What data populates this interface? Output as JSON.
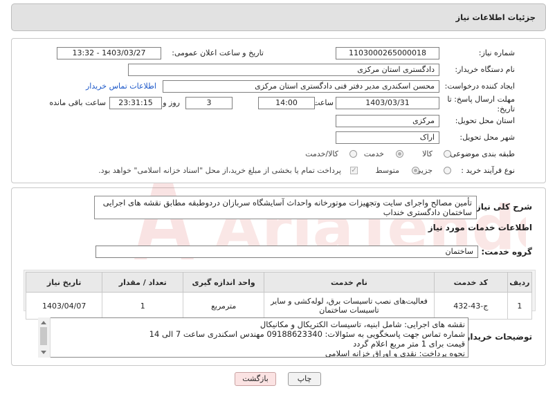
{
  "header": {
    "title": "جزئیات اطلاعات نیاز"
  },
  "form": {
    "need_number_label": "شماره نیاز:",
    "need_number": "1103000265000018",
    "announce_label": "تاریخ و ساعت اعلان عمومی:",
    "announce_value": "1403/03/27 - 13:32",
    "buyer_org_label": "نام دستگاه خریدار:",
    "buyer_org": "دادگستری استان مرکزی",
    "requester_label": "ایجاد کننده درخواست:",
    "requester": "محسن اسکندری مدیر دفتر فنی دادگستری استان مرکزی",
    "contact_link": "اطلاعات تماس خریدار",
    "deadline_label_1": "مهلت ارسال پاسخ: تا",
    "deadline_label_2": "تاریخ:",
    "deadline_date": "1403/03/31",
    "time_label": "ساعت",
    "deadline_time": "14:00",
    "days_value": "3",
    "days_label": "روز و",
    "remaining_time": "23:31:15",
    "remaining_label": "ساعت باقی مانده",
    "province_label": "استان محل تحویل:",
    "province": "مرکزی",
    "city_label": "شهر محل تحویل:",
    "city": "اراک",
    "category_label": "طبقه بندی موضوعی:",
    "category_options": [
      "کالا",
      "خدمت",
      "کالا/خدمت"
    ],
    "process_label": "نوع فرآیند خرید :",
    "process_options": [
      "جزیی",
      "متوسط"
    ],
    "payment_note": "پرداخت تمام یا بخشی از مبلغ خرید،از محل \"اسناد خزانه اسلامی\" خواهد بود."
  },
  "need": {
    "summary_label": "شرح کلی نیاز:",
    "summary": "تأمین مصالح واجرای سایت وتجهیزات موتورخانه واحداث آسایشگاه سربازان دردوطبقه مطابق نقشه های اجرایی ساختمان دادگستری خنداب",
    "services_title": "اطلاعات خدمات مورد نیاز",
    "service_group_label": "گروه خدمت:",
    "service_group": "ساختمان"
  },
  "table": {
    "headers": [
      "ردیف",
      "کد خدمت",
      "نام خدمت",
      "واحد اندازه گیری",
      "تعداد / مقدار",
      "تاریخ نیاز"
    ],
    "rows": [
      [
        "1",
        "ج-43-432",
        "فعالیت‌های نصب تاسیسات برق، لوله‌کشی و سایر تاسیسات ساختمان",
        "مترمربع",
        "1",
        "1403/04/07"
      ]
    ]
  },
  "buyer_notes": {
    "label": "توضیحات خریدار:",
    "lines": [
      "نقشه های اجرایی: شامل ابنیه، تاسیسات الکتریکال و مکانیکال",
      "شماره تماس جهت پاسخگویی به سئوالات: 09188623340 مهندس اسکندری ساعت 7 الی 14",
      "قیمت برای 1 متر مربع اعلام گردد",
      "نحوه پرداخت: نقدی و اوراق خزانه اسلامی"
    ]
  },
  "buttons": {
    "print": "چاپ",
    "back": "بازگشت"
  },
  "watermark": {
    "text": "AriaTender.neT"
  }
}
